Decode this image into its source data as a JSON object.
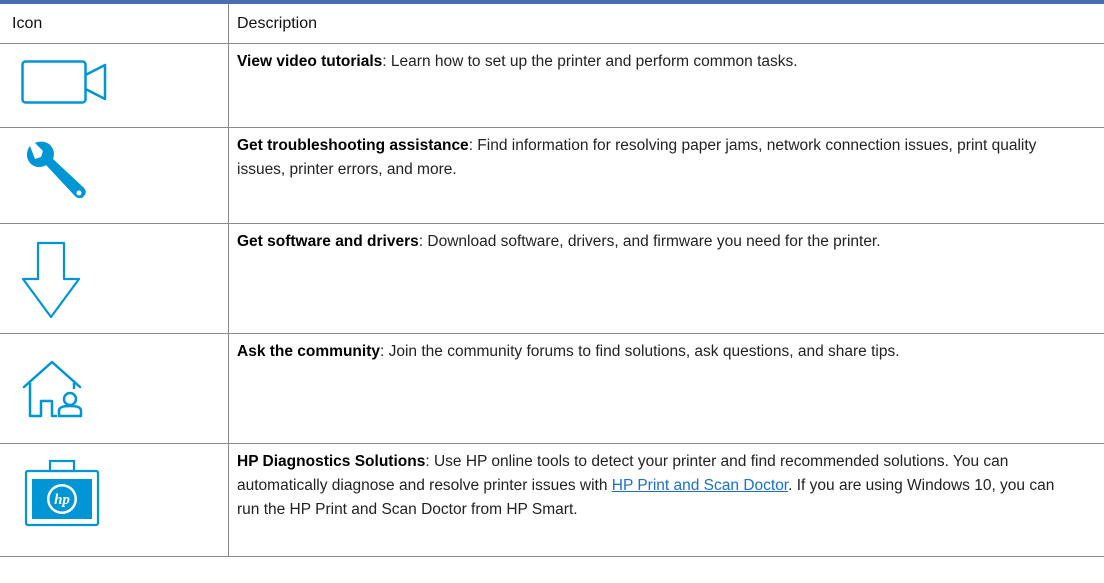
{
  "table": {
    "header": {
      "icon_col": "Icon",
      "desc_col": "Description"
    },
    "rows": [
      {
        "icon": "video-camera-icon",
        "term": "View video tutorials",
        "sep": ":",
        "text": " Learn how to set up the printer and perform common tasks."
      },
      {
        "icon": "wrench-icon",
        "term": "Get troubleshooting assistance",
        "sep": ":",
        "text": " Find information for resolving paper jams, network connection issues, print quality issues, printer errors, and more."
      },
      {
        "icon": "download-arrow-icon",
        "term": "Get software and drivers",
        "sep": ":",
        "text": " Download software, drivers, and firmware you need for the printer."
      },
      {
        "icon": "home-community-icon",
        "term": "Ask the community",
        "sep": ":",
        "text": " Join the community forums to find solutions, ask questions, and share tips."
      },
      {
        "icon": "hp-toolbox-icon",
        "term": "HP Diagnostics Solutions",
        "sep": ":",
        "text_before": " Use HP online tools to detect your printer and find recommended solutions. You can automatically diagnose and resolve printer issues with ",
        "link": "HP Print and Scan Doctor",
        "text_after": ". If you are using Windows 10, you can run the HP Print and Scan Doctor from HP Smart."
      }
    ]
  },
  "colors": {
    "icon_blue": "#0096d6",
    "header_bar": "#4a6eb3",
    "link": "#1a6fd1"
  }
}
